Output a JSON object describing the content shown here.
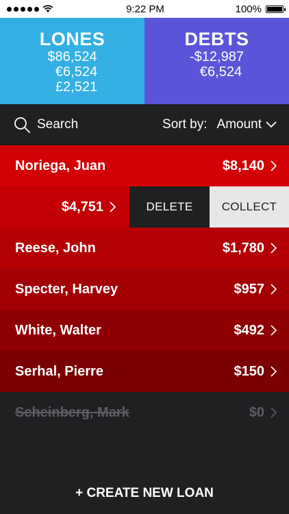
{
  "status_bar": {
    "time": "9:22 PM",
    "battery": "100%"
  },
  "summary": {
    "lones": {
      "title": "LONES",
      "amounts": [
        "$86,524",
        "€6,524",
        "£2,521"
      ]
    },
    "debts": {
      "title": "DEBTS",
      "amounts": [
        "-$12,987",
        "€6,524"
      ]
    }
  },
  "toolbar": {
    "search_label": "Search",
    "sort_label": "Sort by:",
    "sort_value": "Amount"
  },
  "loans": [
    {
      "name": "Noriega, Juan",
      "amount": "$8,140",
      "color": "#d30006"
    },
    {
      "amount": "$4,751",
      "color": "#c20006",
      "swiped": true,
      "actions": [
        "DELETE",
        "COLLECT"
      ]
    },
    {
      "name": "Reese, John",
      "amount": "$1,780",
      "color": "#b40005"
    },
    {
      "name": "Specter, Harvey",
      "amount": "$957",
      "color": "#a30005"
    },
    {
      "name": "White, Walter",
      "amount": "$492",
      "color": "#8f0004"
    },
    {
      "name": "Serhal, Pierre",
      "amount": "$150",
      "color": "#7a0003"
    },
    {
      "name": "Scheinberg, Mark",
      "amount": "$0",
      "settled": true
    }
  ],
  "footer": {
    "create_label": "+ CREATE NEW LOAN"
  }
}
